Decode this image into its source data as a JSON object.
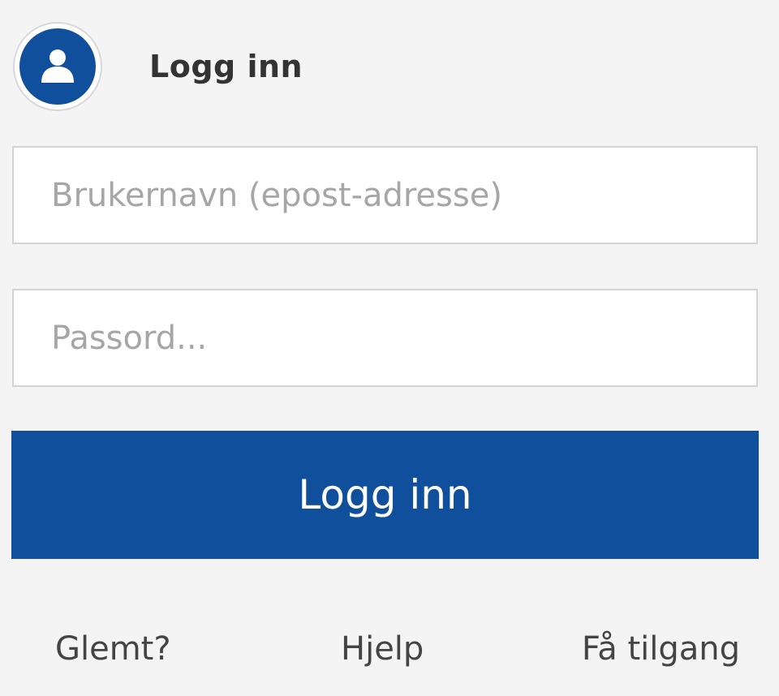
{
  "header": {
    "title": "Logg inn",
    "avatar_icon": "user-icon"
  },
  "form": {
    "username": {
      "value": "",
      "placeholder": "Brukernavn (epost-adresse)"
    },
    "password": {
      "value": "",
      "placeholder": "Passord..."
    },
    "submit_label": "Logg inn"
  },
  "links": {
    "forgot": "Glemt?",
    "help": "Hjelp",
    "access": "Få tilgang"
  },
  "colors": {
    "brand": "#0f4f9b",
    "background": "#f4f4f4",
    "input_border": "#d4d4d4",
    "placeholder": "#a6a6a6"
  }
}
